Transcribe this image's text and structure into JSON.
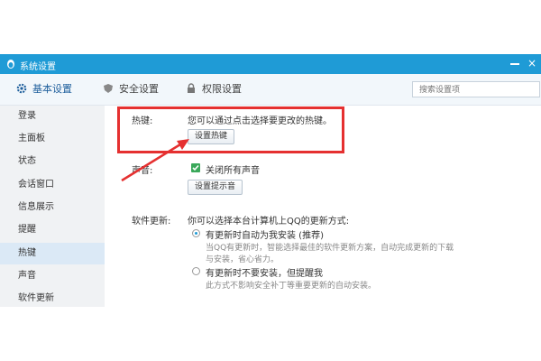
{
  "window": {
    "title": "系统设置"
  },
  "tabs": [
    {
      "label": "基本设置",
      "icon": "gear-icon",
      "active": true
    },
    {
      "label": "安全设置",
      "icon": "shield-icon",
      "active": false
    },
    {
      "label": "权限设置",
      "icon": "lock-icon",
      "active": false
    }
  ],
  "search": {
    "placeholder": "搜索设置项"
  },
  "sidebar": {
    "items": [
      {
        "label": "登录"
      },
      {
        "label": "主面板"
      },
      {
        "label": "状态"
      },
      {
        "label": "会话窗口"
      },
      {
        "label": "信息展示"
      },
      {
        "label": "提醒"
      },
      {
        "label": "热键",
        "active": true
      },
      {
        "label": "声音"
      },
      {
        "label": "软件更新"
      }
    ]
  },
  "hotkey": {
    "label": "热键:",
    "description": "您可以通过点击选择要更改的热键。",
    "button": "设置热键"
  },
  "sound": {
    "label": "声音:",
    "mute_all": "关闭所有声音",
    "mute_all_checked": true,
    "button": "设置提示音"
  },
  "update": {
    "label": "软件更新:",
    "description": "你可以选择本台计算机上QQ的更新方式:",
    "option_auto": "有更新时自动为我安装 (推荐)",
    "option_auto_desc1": "当QQ有更新时，智能选择最佳的软件更新方案，自动完成更新的下载",
    "option_auto_desc2": "与安装，省心省力。",
    "option_manual": "有更新时不要安装，但提醒我",
    "option_manual_desc": "此方式不影响安全补丁等重要更新的自动安装。",
    "selected": "auto"
  },
  "colors": {
    "titlebar": "#1f9bd6",
    "highlight": "#e53030",
    "checkbox": "#3aa85a"
  }
}
